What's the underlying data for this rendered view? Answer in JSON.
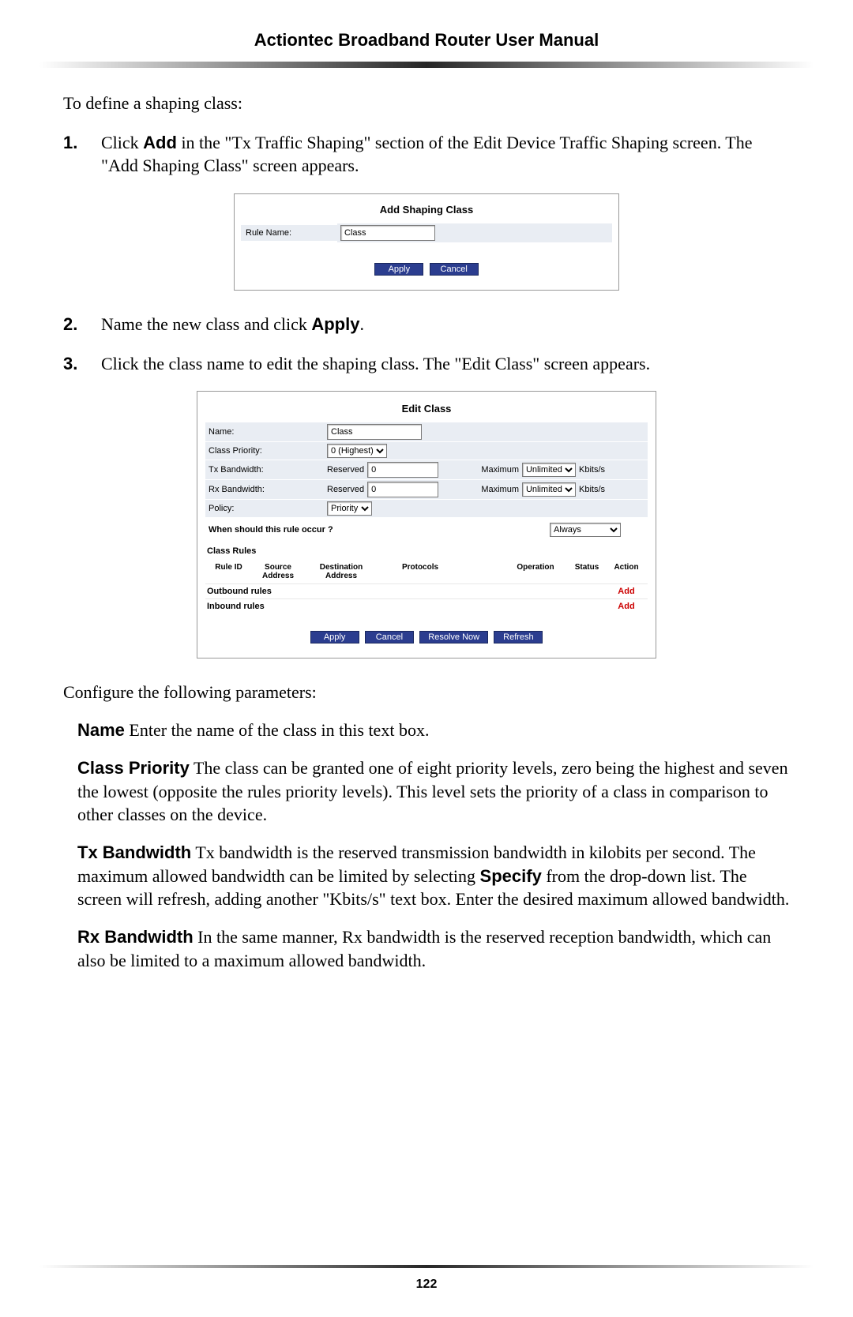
{
  "header": {
    "title": "Actiontec Broadband Router User Manual"
  },
  "intro": "To define a shaping class:",
  "steps": {
    "s1": {
      "num": "1.",
      "pre": "Click ",
      "bold1": "Add",
      "post": " in the \"Tx Traffic Shaping\" section of the Edit Device Traffic Shaping screen. The \"Add Shaping Class\" screen appears."
    },
    "s2": {
      "num": "2.",
      "pre": "Name the new class and click ",
      "bold1": "Apply",
      "post": "."
    },
    "s3": {
      "num": "3.",
      "text": "Click the class name to edit the shaping class. The \"Edit Class\" screen appears."
    }
  },
  "addShaping": {
    "title": "Add Shaping Class",
    "label": "Rule Name:",
    "value": "Class",
    "apply": "Apply",
    "cancel": "Cancel"
  },
  "editClass": {
    "title": "Edit Class",
    "nameLabel": "Name:",
    "nameValue": "Class",
    "priorityLabel": "Class Priority:",
    "priorityValue": "0 (Highest)",
    "txLabel": "Tx Bandwidth:",
    "rxLabel": "Rx Bandwidth:",
    "reserved": "Reserved",
    "reservedTx": "0",
    "reservedRx": "0",
    "maximum": "Maximum",
    "maxSel": "Unlimited",
    "unit": "Kbits/s",
    "policyLabel": "Policy:",
    "policyValue": "Priority",
    "whenLabel": "When should this rule occur ?",
    "whenValue": "Always",
    "classRules": "Class Rules",
    "cols": {
      "rid": "Rule ID",
      "src": "Source Address",
      "dst": "Destination Address",
      "proto": "Protocols",
      "op": "Operation",
      "status": "Status",
      "action": "Action"
    },
    "outbound": "Outbound rules",
    "inbound": "Inbound rules",
    "add": "Add",
    "buttons": {
      "apply": "Apply",
      "cancel": "Cancel",
      "resolve": "Resolve Now",
      "refresh": "Refresh"
    }
  },
  "configIntro": "Configure the following parameters:",
  "params": {
    "name": {
      "label": "Name",
      "text": "  Enter the name of the class in this text box."
    },
    "priority": {
      "label": "Class Priority",
      "text": "  The class can be granted one of eight priority levels, zero being the highest and seven the lowest (opposite the rules priority levels). This level sets the priority of a class in comparison to other classes on the device."
    },
    "tx": {
      "label": "Tx Bandwidth",
      "pre": "  Tx bandwidth is the reserved transmission bandwidth in kilobits per second. The maximum allowed bandwidth can be limited by selecting ",
      "bold": "Specify",
      "post": " from the drop-down list. The screen will refresh, adding another \"Kbits/s\" text box. Enter the desired maximum allowed bandwidth."
    },
    "rx": {
      "label": "Rx Bandwidth",
      "text": "  In the same manner, Rx bandwidth is the reserved reception bandwidth, which can also be limited to a maximum allowed bandwidth."
    }
  },
  "pageNumber": "122"
}
